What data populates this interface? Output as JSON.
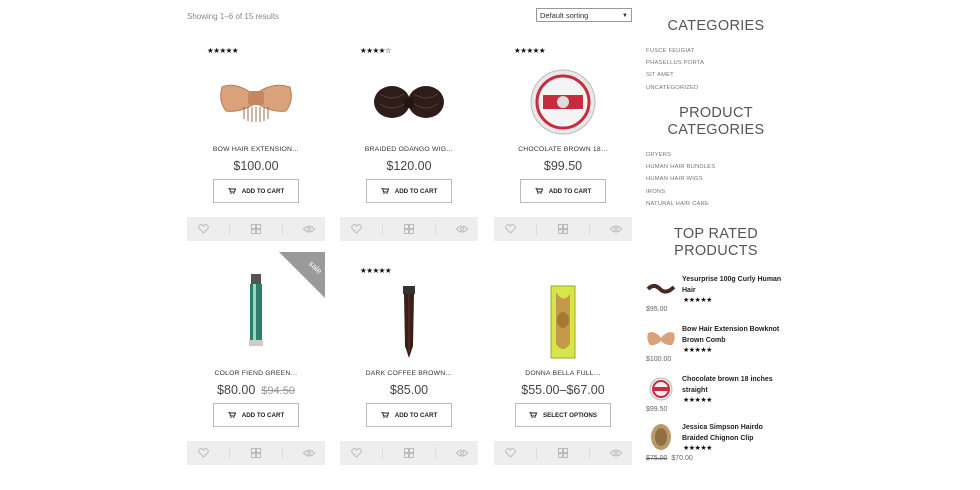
{
  "toolbar": {
    "results": "Showing 1–6 of 15 results",
    "sort_selected": "Default sorting"
  },
  "products": [
    {
      "name": "BOW HAIR EXTENSION…",
      "price": "$100.00",
      "old_price": "",
      "stars": "★★★★★",
      "button": "ADD TO CART",
      "sale": false
    },
    {
      "name": "BRAIDED ODANGO WIG…",
      "price": "$120.00",
      "old_price": "",
      "stars": "★★★★☆",
      "button": "ADD TO CART",
      "sale": false
    },
    {
      "name": "CHOCOLATE BROWN 18…",
      "price": "$99.50",
      "old_price": "",
      "stars": "★★★★★",
      "button": "ADD TO CART",
      "sale": false
    },
    {
      "name": "COLOR FIEND GREEN…",
      "price": "$80.00",
      "old_price": "$94.50",
      "stars": "",
      "button": "ADD TO CART",
      "sale": true,
      "sale_label": "sale"
    },
    {
      "name": "DARK COFFEE BROWN…",
      "price": "$85.00",
      "old_price": "",
      "stars": "★★★★★",
      "button": "ADD TO CART",
      "sale": false
    },
    {
      "name": "DONNA BELLA FULL…",
      "price": "$55.00–$67.00",
      "old_price": "",
      "stars": "",
      "button": "SELECT OPTIONS",
      "sale": false
    }
  ],
  "sidebar": {
    "categories_title": "CATEGORIES",
    "categories": [
      "FUSCE FEUGIAT",
      "PHASELLUS PORTA",
      "SIT AMET",
      "UNCATEGORIZED"
    ],
    "product_categories_title_1": "PRODUCT",
    "product_categories_title_2": "CATEGORIES",
    "product_categories": [
      "DRYERS",
      "HUMAN HAIR BUNDLES",
      "HUMAN HAIR WIGS",
      "IRONS",
      "NATURAL HAIR CARE"
    ],
    "top_rated_title_1": "TOP RATED",
    "top_rated_title_2": "PRODUCTS",
    "top_rated": [
      {
        "title": "Yesurprise 100g Curly Human Hair",
        "stars": "★★★★★",
        "price": "$95.00",
        "old_price": ""
      },
      {
        "title": "Bow Hair Extension Bowknot Brown Comb",
        "stars": "★★★★★",
        "price": "$100.00",
        "old_price": ""
      },
      {
        "title": "Chocolate brown 18 inches straight",
        "stars": "★★★★★",
        "price": "$99.50",
        "old_price": ""
      },
      {
        "title": "Jessica Simpson Hairdo Braided Chignon Clip",
        "stars": "★★★★★",
        "price": "$70.00",
        "old_price": "$75.00"
      }
    ]
  },
  "colors": {
    "sale_ribbon": "#9a9a9a",
    "action_bar": "#eeeeee"
  }
}
